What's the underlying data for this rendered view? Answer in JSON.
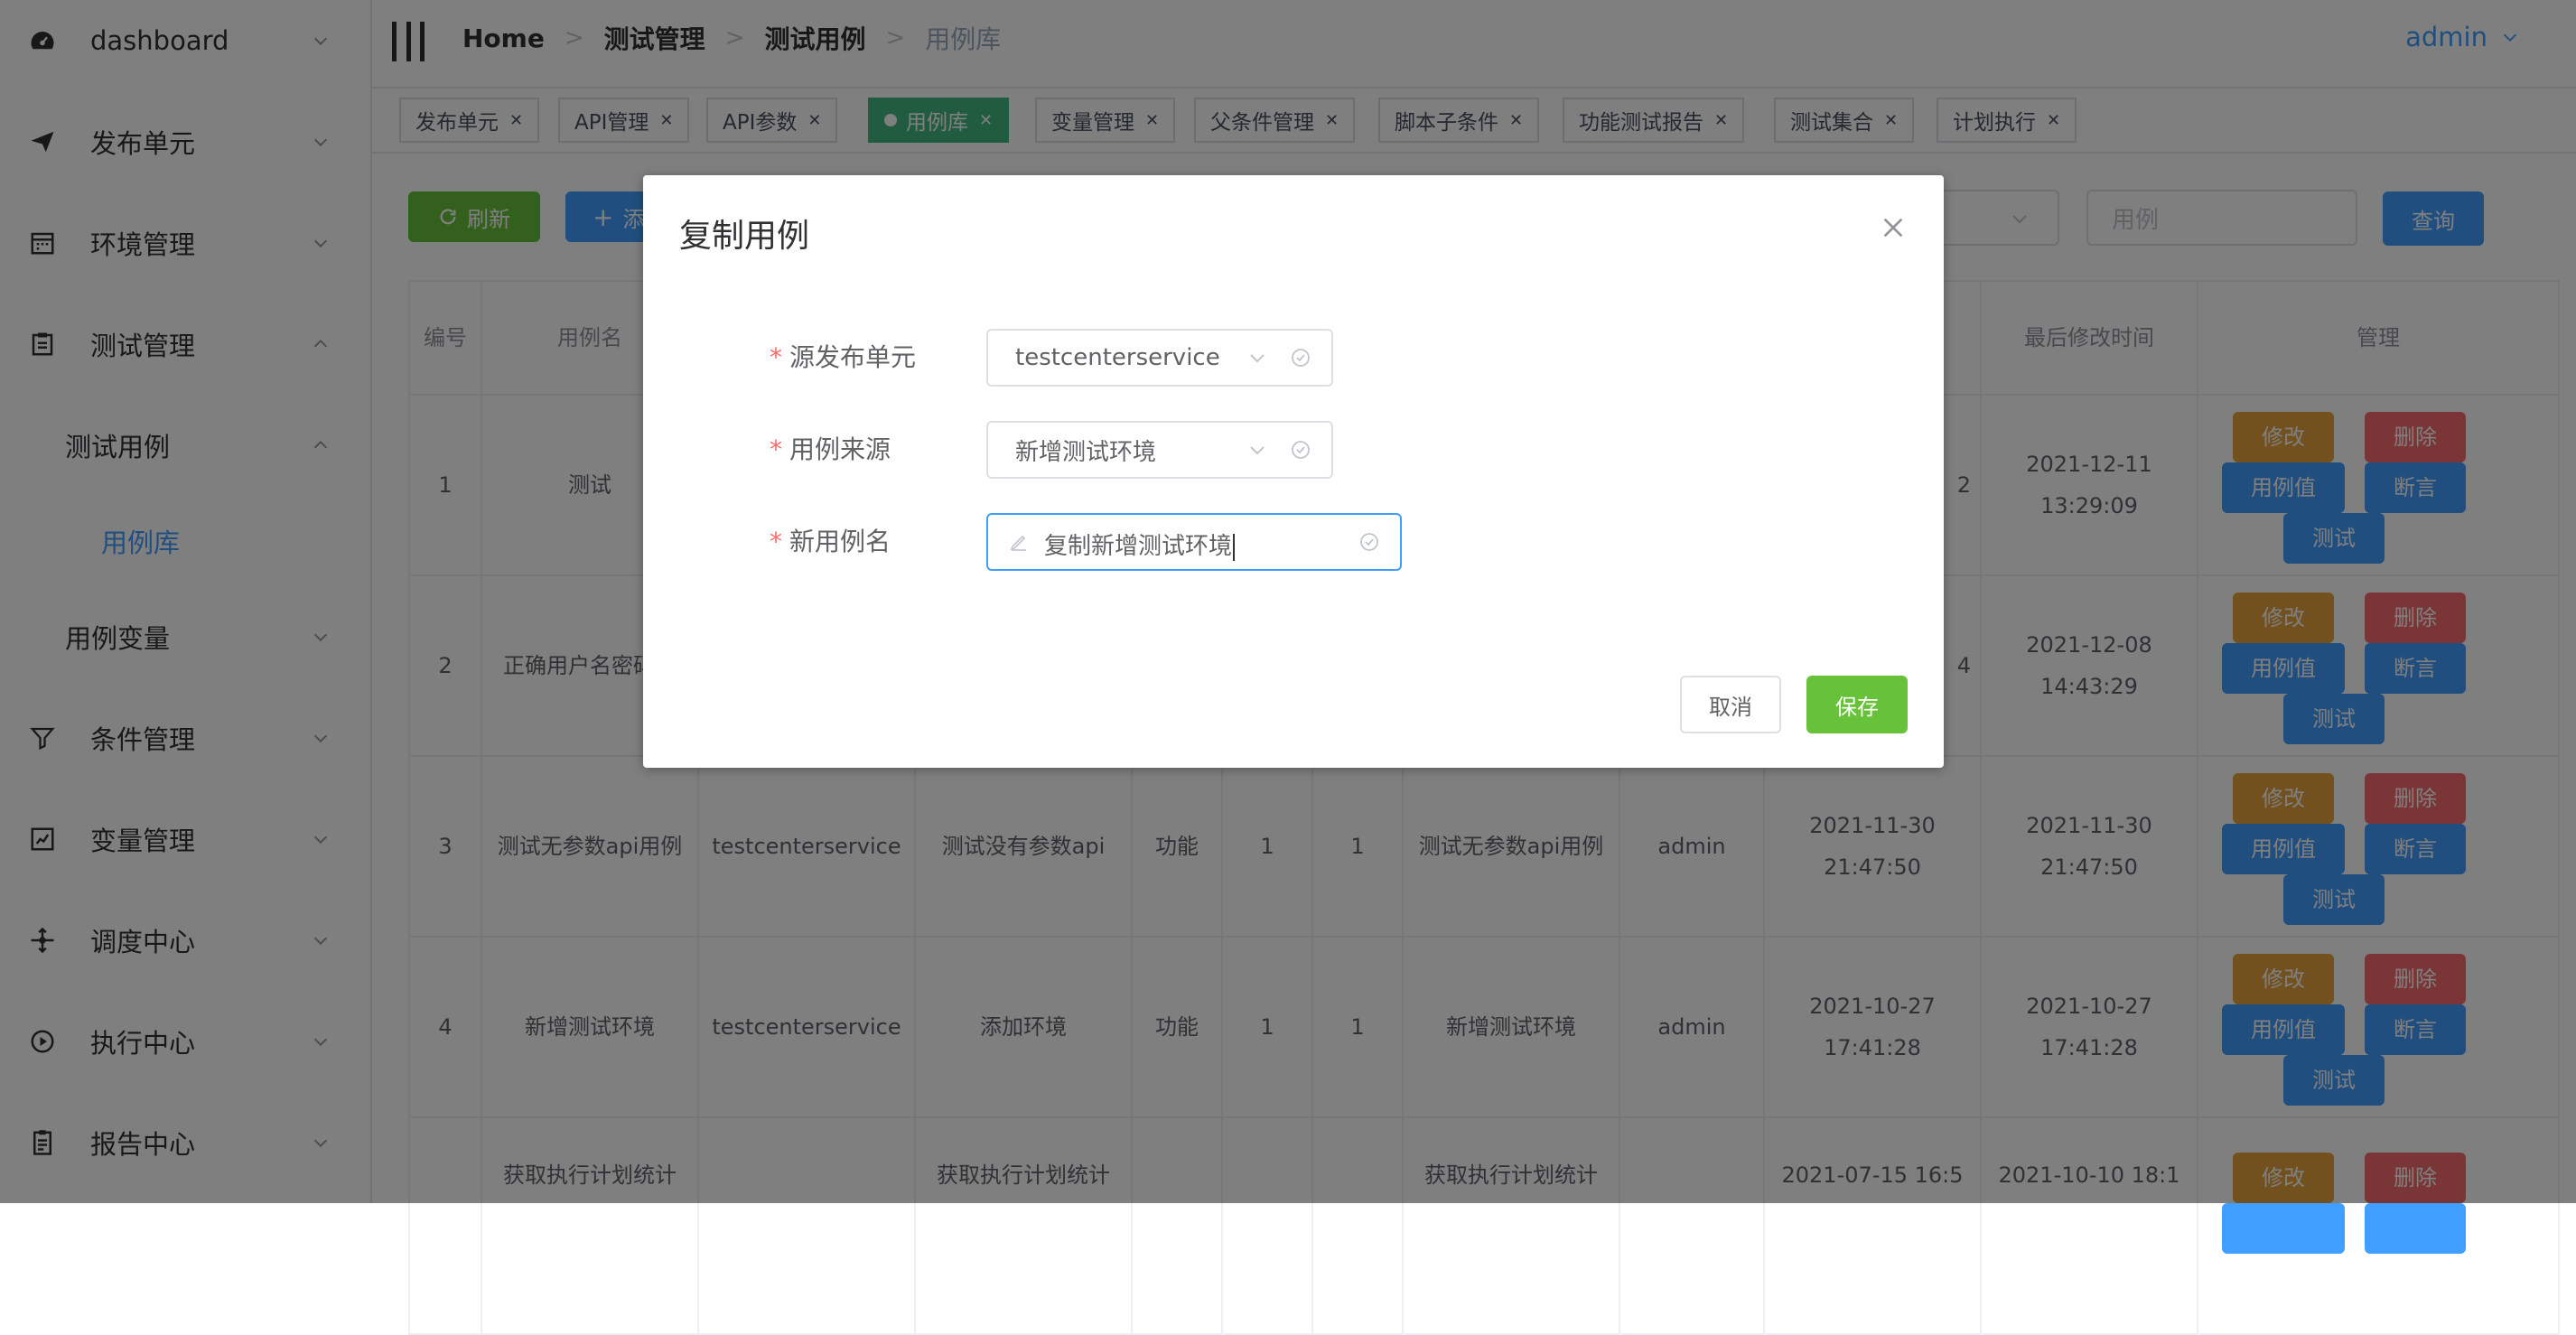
{
  "sidebar": {
    "items": [
      {
        "label": "dashboard",
        "icon": "dashboard-icon"
      },
      {
        "label": "发布单元",
        "icon": "send-icon"
      },
      {
        "label": "环境管理",
        "icon": "calendar-icon"
      },
      {
        "label": "测试管理",
        "icon": "clipboard-icon"
      },
      {
        "label": "测试用例"
      },
      {
        "label": "用例库"
      },
      {
        "label": "用例变量"
      },
      {
        "label": "条件管理",
        "icon": "filter-icon"
      },
      {
        "label": "变量管理",
        "icon": "chart-box-icon"
      },
      {
        "label": "调度中心",
        "icon": "scheduler-icon"
      },
      {
        "label": "执行中心",
        "icon": "play-circle-icon"
      },
      {
        "label": "报告中心",
        "icon": "report-icon"
      }
    ]
  },
  "header": {
    "breadcrumb": [
      "Home",
      "测试管理",
      "测试用例",
      "用例库"
    ],
    "user": "admin"
  },
  "tags": [
    {
      "label": "发布单元",
      "active": false
    },
    {
      "label": "API管理",
      "active": false
    },
    {
      "label": "API参数",
      "active": false
    },
    {
      "label": "用例库",
      "active": true
    },
    {
      "label": "变量管理",
      "active": false
    },
    {
      "label": "父条件管理",
      "active": false
    },
    {
      "label": "脚本子条件",
      "active": false
    },
    {
      "label": "功能测试报告",
      "active": false
    },
    {
      "label": "测试集合",
      "active": false
    },
    {
      "label": "计划执行",
      "active": false
    }
  ],
  "toolbar": {
    "refresh_label": "刷新",
    "add_label": "添",
    "search_placeholder": "用例",
    "query_label": "查询"
  },
  "table": {
    "headers": [
      "编号",
      "用例名",
      "",
      "",
      "",
      "",
      "",
      "",
      "",
      "",
      "最后修改时间",
      "管理"
    ],
    "rows": [
      [
        "1",
        "测试",
        "",
        "",
        "",
        "",
        "",
        "",
        "",
        "2",
        "2021-12-11 13:29:09"
      ],
      [
        "2",
        "正确用户名密码陆",
        "",
        "",
        "",
        "",
        "",
        "",
        "",
        "4",
        "2021-12-08 14:43:29"
      ],
      [
        "3",
        "测试无参数api用例",
        "testcenterservice",
        "测试没有参数api",
        "功能",
        "1",
        "1",
        "测试无参数api用例",
        "admin",
        "2021-11-30 21:47:50",
        "2021-11-30 21:47:50"
      ],
      [
        "4",
        "新增测试环境",
        "testcenterservice",
        "添加环境",
        "功能",
        "1",
        "1",
        "新增测试环境",
        "admin",
        "2021-10-27 17:41:28",
        "2021-10-27 17:41:28"
      ],
      [
        "",
        "获取执行计划统计",
        "",
        "获取执行计划统计",
        "",
        "",
        "",
        "获取执行计划统计",
        "",
        "2021-07-15 16:5",
        "2021-10-10 18:1"
      ]
    ],
    "actions": {
      "edit": "修改",
      "delete": "删除",
      "values": "用例值",
      "assert": "断言",
      "test": "测试"
    }
  },
  "dialog": {
    "title": "复制用例",
    "fields": [
      {
        "label": "源发布单元",
        "value": "testcenterservice"
      },
      {
        "label": "用例来源",
        "value": "新增测试环境"
      },
      {
        "label": "新用例名",
        "value": "复制新增测试环境"
      }
    ],
    "cancel_label": "取消",
    "save_label": "保存"
  }
}
